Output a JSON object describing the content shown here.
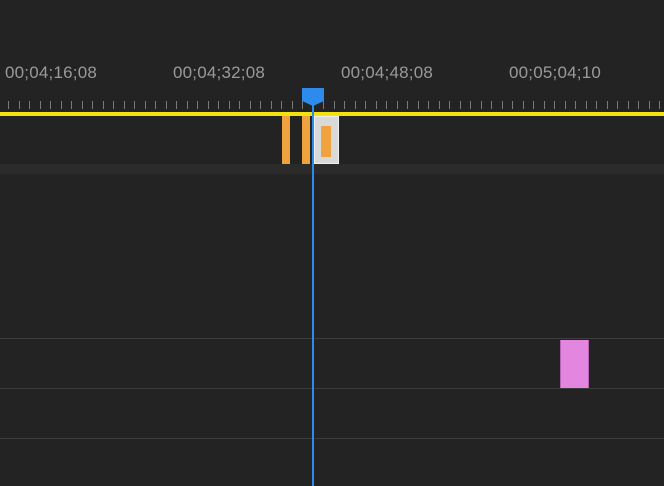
{
  "timeline": {
    "ruler_labels": [
      {
        "text": "00;04;16;08"
      },
      {
        "text": "00;04;32;08"
      },
      {
        "text": "00;04;48;08"
      },
      {
        "text": "00;05;04;10"
      }
    ]
  },
  "colors": {
    "background": "#232323",
    "work_area_bar": "#f4e20e",
    "playhead": "#2d8ceb",
    "clip_audio": "#efa33f",
    "clip_selected": "#d9d9d9",
    "clip_pink": "#e286e0",
    "ruler_text": "#9a9a9a"
  },
  "icons": {
    "playhead": "playhead-marker-icon"
  }
}
